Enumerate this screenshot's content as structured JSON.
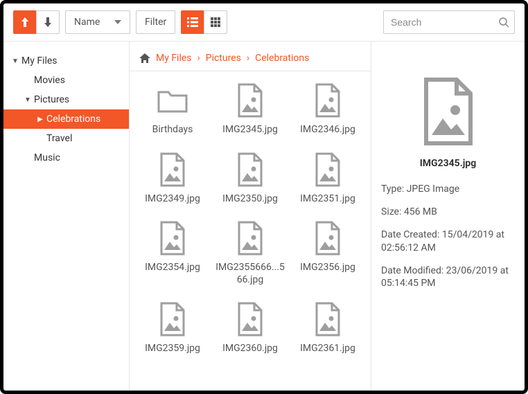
{
  "toolbar": {
    "sort_label": "Name",
    "filter_label": "Filter"
  },
  "search": {
    "placeholder": "Search"
  },
  "tree": {
    "root": "My Files",
    "movies": "Movies",
    "pictures": "Pictures",
    "celebrations": "Celebrations",
    "travel": "Travel",
    "music": "Music"
  },
  "breadcrumbs": [
    "My Files",
    "Pictures",
    "Celebrations"
  ],
  "files": [
    {
      "name": "Birthdays",
      "type": "folder"
    },
    {
      "name": "IMG2345.jpg",
      "type": "image"
    },
    {
      "name": "IMG2346.jpg",
      "type": "image"
    },
    {
      "name": "IMG2349.jpg",
      "type": "image"
    },
    {
      "name": "IMG2350.jpg",
      "type": "image"
    },
    {
      "name": "IMG2351.jpg",
      "type": "image"
    },
    {
      "name": "IMG2354.jpg",
      "type": "image"
    },
    {
      "name": "IMG2355666...566.jpg",
      "type": "image"
    },
    {
      "name": "IMG2356.jpg",
      "type": "image"
    },
    {
      "name": "IMG2359.jpg",
      "type": "image"
    },
    {
      "name": "IMG2360.jpg",
      "type": "image"
    },
    {
      "name": "IMG2361.jpg",
      "type": "image"
    }
  ],
  "details": {
    "filename": "IMG2345.jpg",
    "type_label": "Type:",
    "type_value": "JPEG Image",
    "size_label": "Size:",
    "size_value": "456 MB",
    "created_label": "Date Created:",
    "created_value": "15/04/2019 at 02:56:12 AM",
    "modified_label": "Date Modified:",
    "modified_value": "23/06/2019 at 05:14:45 PM"
  }
}
